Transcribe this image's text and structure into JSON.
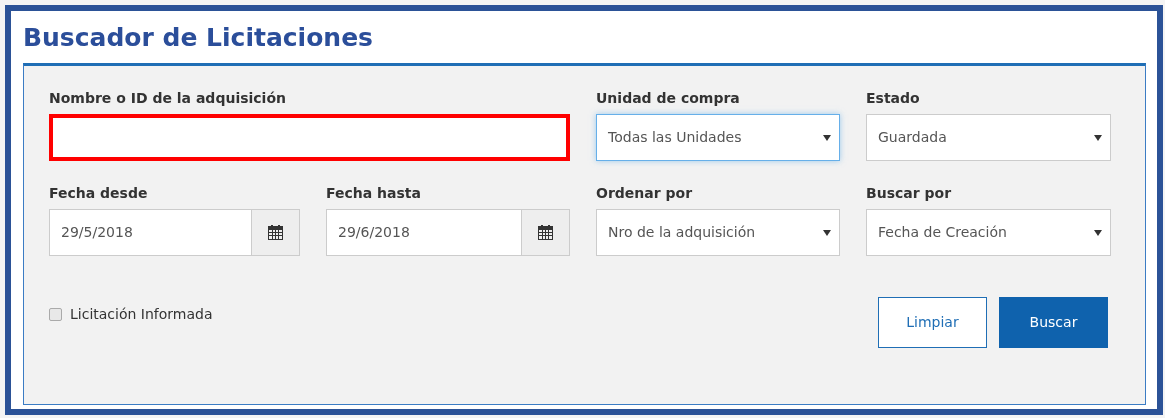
{
  "title": "Buscador de Licitaciones",
  "fields": [
    {
      "kind": "text",
      "label": "Nombre o ID de la adquisición",
      "highlighted": true,
      "focused": false
    },
    {
      "kind": "select",
      "label": "Unidad de compra",
      "value": "Todas las Unidades",
      "highlighted": false,
      "focused": true
    },
    {
      "kind": "select",
      "label": "Estado",
      "value": "Guardada",
      "highlighted": false,
      "focused": false
    },
    {
      "kind": "date",
      "label": "Fecha desde",
      "value": "29/5/2018",
      "highlighted": false,
      "focused": false
    },
    {
      "kind": "date",
      "label": "Fecha hasta",
      "value": "29/6/2018",
      "highlighted": false,
      "focused": false
    },
    {
      "kind": "select",
      "label": "Ordenar por",
      "value": "Nro de la adquisición",
      "highlighted": false,
      "focused": false
    },
    {
      "kind": "select",
      "label": "Buscar por",
      "value": "Fecha de Creación",
      "highlighted": false,
      "focused": false
    }
  ],
  "checkbox": {
    "label": "Licitación Informada",
    "checked": false
  },
  "buttons": [
    {
      "kind": "secondary",
      "label": "Limpiar"
    },
    {
      "kind": "primary",
      "label": "Buscar"
    }
  ]
}
